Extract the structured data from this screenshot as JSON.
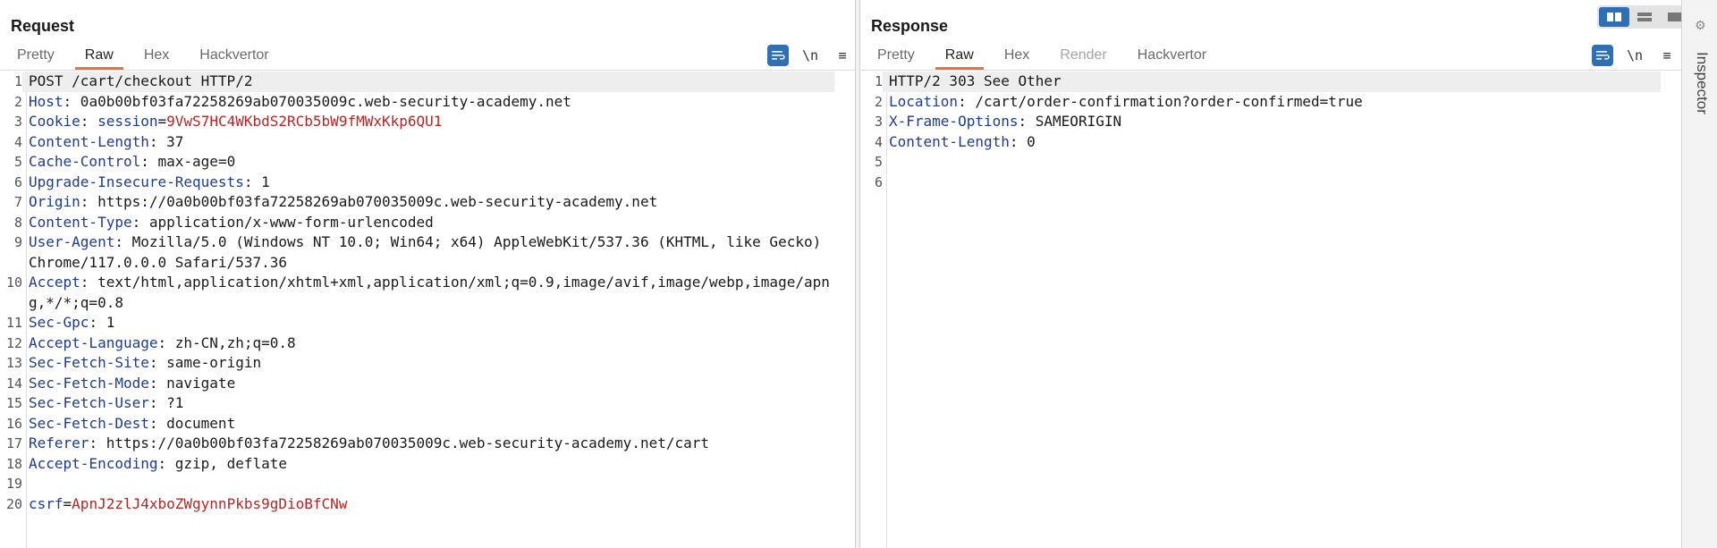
{
  "request": {
    "title": "Request",
    "tabs": [
      {
        "label": "Pretty",
        "state": "normal"
      },
      {
        "label": "Raw",
        "state": "active"
      },
      {
        "label": "Hex",
        "state": "normal"
      },
      {
        "label": "Hackvertor",
        "state": "normal"
      }
    ],
    "newline_label": "\\n",
    "menu_label": "≡",
    "lines": [
      {
        "n": "1",
        "k": "",
        "v": "POST /cart/checkout HTTP/2"
      },
      {
        "n": "2",
        "k": "Host",
        "v": " 0a0b00bf03fa72258269ab070035009c.web-security-academy.net"
      },
      {
        "n": "3",
        "k": "Cookie",
        "v": " ",
        "cookie_name": "session",
        "cookie_val": "9VwS7HC4WKbdS2RCb5bW9fMWxKkp6QU1"
      },
      {
        "n": "4",
        "k": "Content-Length",
        "v": " 37"
      },
      {
        "n": "5",
        "k": "Cache-Control",
        "v": " max-age=0"
      },
      {
        "n": "6",
        "k": "Upgrade-Insecure-Requests",
        "v": " 1"
      },
      {
        "n": "7",
        "k": "Origin",
        "v": " https://0a0b00bf03fa72258269ab070035009c.web-security-academy.net"
      },
      {
        "n": "8",
        "k": "Content-Type",
        "v": " application/x-www-form-urlencoded"
      },
      {
        "n": "9",
        "k": "User-Agent",
        "v": " Mozilla/5.0 (Windows NT 10.0; Win64; x64) AppleWebKit/537.36 (KHTML, like Gecko) Chrome/117.0.0.0 Safari/537.36"
      },
      {
        "n": "10",
        "k": "Accept",
        "v": " text/html,application/xhtml+xml,application/xml;q=0.9,image/avif,image/webp,image/apng,*/*;q=0.8"
      },
      {
        "n": "11",
        "k": "Sec-Gpc",
        "v": " 1"
      },
      {
        "n": "12",
        "k": "Accept-Language",
        "v": " zh-CN,zh;q=0.8"
      },
      {
        "n": "13",
        "k": "Sec-Fetch-Site",
        "v": " same-origin"
      },
      {
        "n": "14",
        "k": "Sec-Fetch-Mode",
        "v": " navigate"
      },
      {
        "n": "15",
        "k": "Sec-Fetch-User",
        "v": " ?1"
      },
      {
        "n": "16",
        "k": "Sec-Fetch-Dest",
        "v": " document"
      },
      {
        "n": "17",
        "k": "Referer",
        "v": " https://0a0b00bf03fa72258269ab070035009c.web-security-academy.net/cart"
      },
      {
        "n": "18",
        "k": "Accept-Encoding",
        "v": " gzip, deflate"
      },
      {
        "n": "19",
        "k": "",
        "v": ""
      },
      {
        "n": "20",
        "k": "",
        "v": "",
        "param_name": "csrf",
        "param_val": "ApnJ2zlJ4xboZWgynnPkbs9gDioBfCNw"
      }
    ]
  },
  "response": {
    "title": "Response",
    "tabs": [
      {
        "label": "Pretty",
        "state": "normal"
      },
      {
        "label": "Raw",
        "state": "active"
      },
      {
        "label": "Hex",
        "state": "normal"
      },
      {
        "label": "Render",
        "state": "disabled"
      },
      {
        "label": "Hackvertor",
        "state": "normal"
      }
    ],
    "newline_label": "\\n",
    "menu_label": "≡",
    "lines": [
      {
        "n": "1",
        "k": "",
        "v": "HTTP/2 303 See Other"
      },
      {
        "n": "2",
        "k": "Location",
        "v": " /cart/order-confirmation?order-confirmed=true"
      },
      {
        "n": "3",
        "k": "X-Frame-Options",
        "v": " SAMEORIGIN"
      },
      {
        "n": "4",
        "k": "Content-Length",
        "v": " 0"
      },
      {
        "n": "5",
        "k": "",
        "v": ""
      },
      {
        "n": "6",
        "k": "",
        "v": ""
      }
    ]
  },
  "sidebar": {
    "inspector_label": "Inspector"
  },
  "colors": {
    "accent": "#e8743b",
    "header_key": "#1f3d8a",
    "value_red": "#b52727",
    "button_blue": "#2f6fb5"
  }
}
